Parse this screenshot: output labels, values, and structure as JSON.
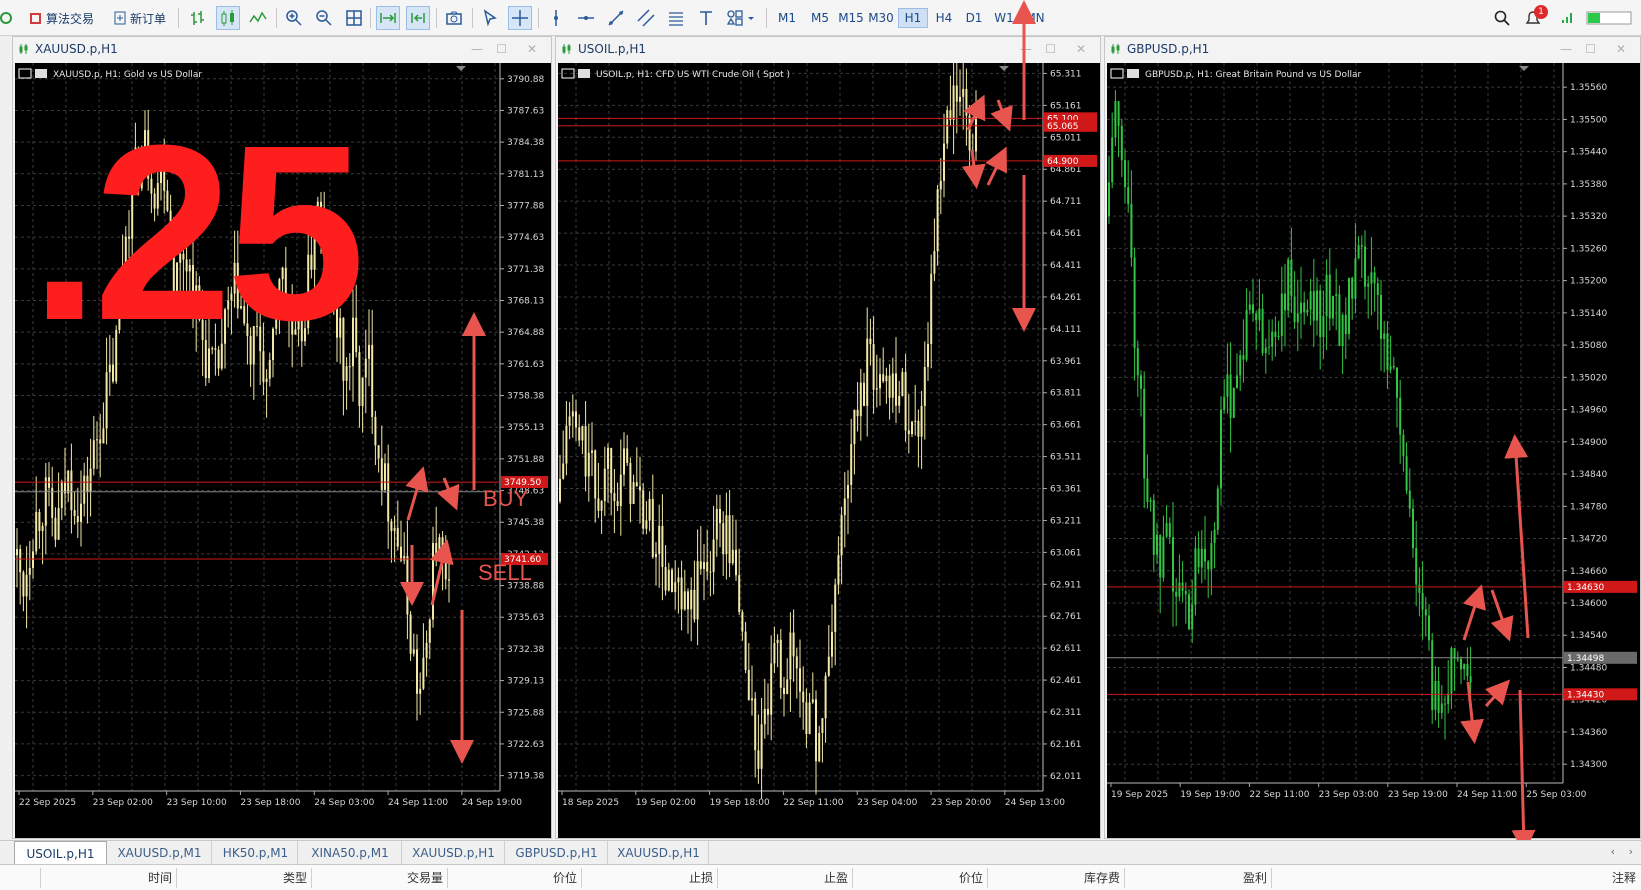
{
  "toolbar": {
    "algo_label": "算法交易",
    "neworder_label": "新订单",
    "timeframes": [
      "M1",
      "M5",
      "M15",
      "M30",
      "H1",
      "H4",
      "D1",
      "W1",
      "MN"
    ],
    "active_timeframe": "H1",
    "notification_count": "1"
  },
  "windows": [
    {
      "title": "XAUUSD.p,H1",
      "info": "XAUUSD.p, H1:  Gold vs US Dollar",
      "price_labels": [
        "3790.88",
        "3787.63",
        "3784.38",
        "3781.13",
        "3777.88",
        "3774.63",
        "3771.38",
        "3768.13",
        "3764.88",
        "3761.63",
        "3758.38",
        "3755.13",
        "3751.88",
        "3748.63",
        "3745.38",
        "3742.13",
        "3738.88",
        "3735.63",
        "3732.38",
        "3729.13",
        "3725.88",
        "3722.63",
        "3719.38"
      ],
      "time_labels": [
        "22 Sep 2025",
        "23 Sep 02:00",
        "23 Sep 10:00",
        "23 Sep 18:00",
        "24 Sep 03:00",
        "24 Sep 11:00",
        "24 Sep 19:00"
      ],
      "level_tags": [
        "3749.50",
        "3741.60"
      ]
    },
    {
      "title": "USOIL.p,H1",
      "info": "USOIL.p, H1:  CFD US WTI Crude Oil ( Spot )",
      "price_labels": [
        "65.311",
        "65.161",
        "65.011",
        "64.861",
        "64.711",
        "64.561",
        "64.411",
        "64.261",
        "64.111",
        "63.961",
        "63.811",
        "63.661",
        "63.511",
        "63.361",
        "63.211",
        "63.061",
        "62.911",
        "62.761",
        "62.611",
        "62.461",
        "62.311",
        "62.161",
        "62.011"
      ],
      "time_labels": [
        "18 Sep 2025",
        "19 Sep 02:00",
        "19 Sep 18:00",
        "22 Sep 11:00",
        "23 Sep 04:00",
        "23 Sep 20:00",
        "24 Sep 13:00"
      ],
      "level_tags": [
        "65.100",
        "65.065",
        "64.900"
      ]
    },
    {
      "title": "GBPUSD.p,H1",
      "info": "GBPUSD.p, H1:  Great Britain Pound vs US Dollar",
      "price_labels": [
        "1.35560",
        "1.35500",
        "1.35440",
        "1.35380",
        "1.35320",
        "1.35260",
        "1.35200",
        "1.35140",
        "1.35080",
        "1.35020",
        "1.34960",
        "1.34900",
        "1.34840",
        "1.34780",
        "1.34720",
        "1.34660",
        "1.34600",
        "1.34540",
        "1.34480",
        "1.34420",
        "1.34360",
        "1.34300"
      ],
      "time_labels": [
        "19 Sep 2025",
        "19 Sep 19:00",
        "22 Sep 11:00",
        "23 Sep 03:00",
        "23 Sep 19:00",
        "24 Sep 11:00",
        "25 Sep 03:00"
      ],
      "level_tags": [
        "1.34630",
        "1.34498",
        "1.34430"
      ]
    }
  ],
  "overlay": {
    "big_number": ".25",
    "buy_text": "BUY",
    "sell_text": "SELL"
  },
  "tabs": [
    "USOIL.p,H1",
    "XAUUSD.p,M1",
    "HK50.p,M1",
    "XINA50.p,M1",
    "XAUUSD.p,H1",
    "GBPUSD.p,H1",
    "XAUUSD.p,H1"
  ],
  "active_tab": "USOIL.p,H1",
  "columns": [
    "时间",
    "类型",
    "交易量",
    "价位",
    "止损",
    "止盈",
    "价位",
    "库存费",
    "盈利",
    "注释"
  ],
  "colors": {
    "gold_candle": "#f2e9a8",
    "green_candle": "#33c544",
    "level_line": "#d01818",
    "arrow": "#e8554e",
    "overlay_red": "#ff1e1e"
  }
}
